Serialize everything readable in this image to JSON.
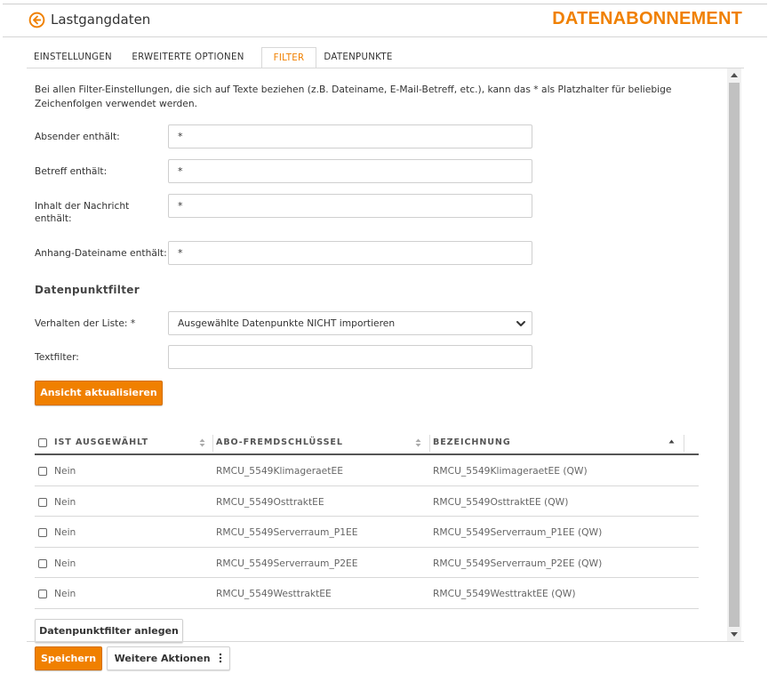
{
  "header": {
    "title": "Lastgangdaten",
    "brand": "DATENABONNEMENT",
    "accent_color": "#f08000",
    "back_icon": "arrow-left-circle-icon"
  },
  "tabs": [
    {
      "label": "EINSTELLUNGEN",
      "active": false
    },
    {
      "label": "ERWEITERTE OPTIONEN",
      "active": false
    },
    {
      "label": "FILTER",
      "active": true
    },
    {
      "label": "DATENPUNKTE",
      "active": false
    }
  ],
  "filter": {
    "hint": "Bei allen Filter-Einstellungen, die sich auf Texte beziehen (z.B. Dateiname, E-Mail-Betreff, etc.), kann das * als Platzhalter für beliebige Zeichenfolgen verwendet werden.",
    "fields": [
      {
        "label": "Absender enthält:",
        "value": "*"
      },
      {
        "label": "Betreff enthält:",
        "value": "*"
      },
      {
        "label": "Inhalt der Nachricht enthält:",
        "value": "*"
      },
      {
        "label": "Anhang-Dateiname enthält:",
        "value": "*"
      }
    ]
  },
  "datenpunktfilter": {
    "section_title": "Datenpunktfilter",
    "verhalten_label": "Verhalten der Liste: *",
    "verhalten_value": "Ausgewählte Datenpunkte NICHT importieren",
    "textfilter_label": "Textfilter:",
    "textfilter_value": "",
    "refresh_button": "Ansicht aktualisieren"
  },
  "table": {
    "columns": [
      "IST AUSGEWÄHLT",
      "ABO-FREMDSCHLÜSSEL",
      "BEZEICHNUNG"
    ],
    "rows": [
      {
        "selected": "Nein",
        "key": "RMCU_5549KlimageraetEE",
        "name": "RMCU_5549KlimageraetEE (QW)"
      },
      {
        "selected": "Nein",
        "key": "RMCU_5549OsttraktEE",
        "name": "RMCU_5549OsttraktEE (QW)"
      },
      {
        "selected": "Nein",
        "key": "RMCU_5549Serverraum_P1EE",
        "name": "RMCU_5549Serverraum_P1EE (QW)"
      },
      {
        "selected": "Nein",
        "key": "RMCU_5549Serverraum_P2EE",
        "name": "RMCU_5549Serverraum_P2EE (QW)"
      },
      {
        "selected": "Nein",
        "key": "RMCU_5549WesttraktEE",
        "name": "RMCU_5549WesttraktEE (QW)"
      }
    ],
    "create_filter_button": "Datenpunktfilter anlegen"
  },
  "footer": {
    "save_button": "Speichern",
    "more_actions_button": "Weitere Aktionen",
    "more_icon": "vertical-dots-icon"
  }
}
